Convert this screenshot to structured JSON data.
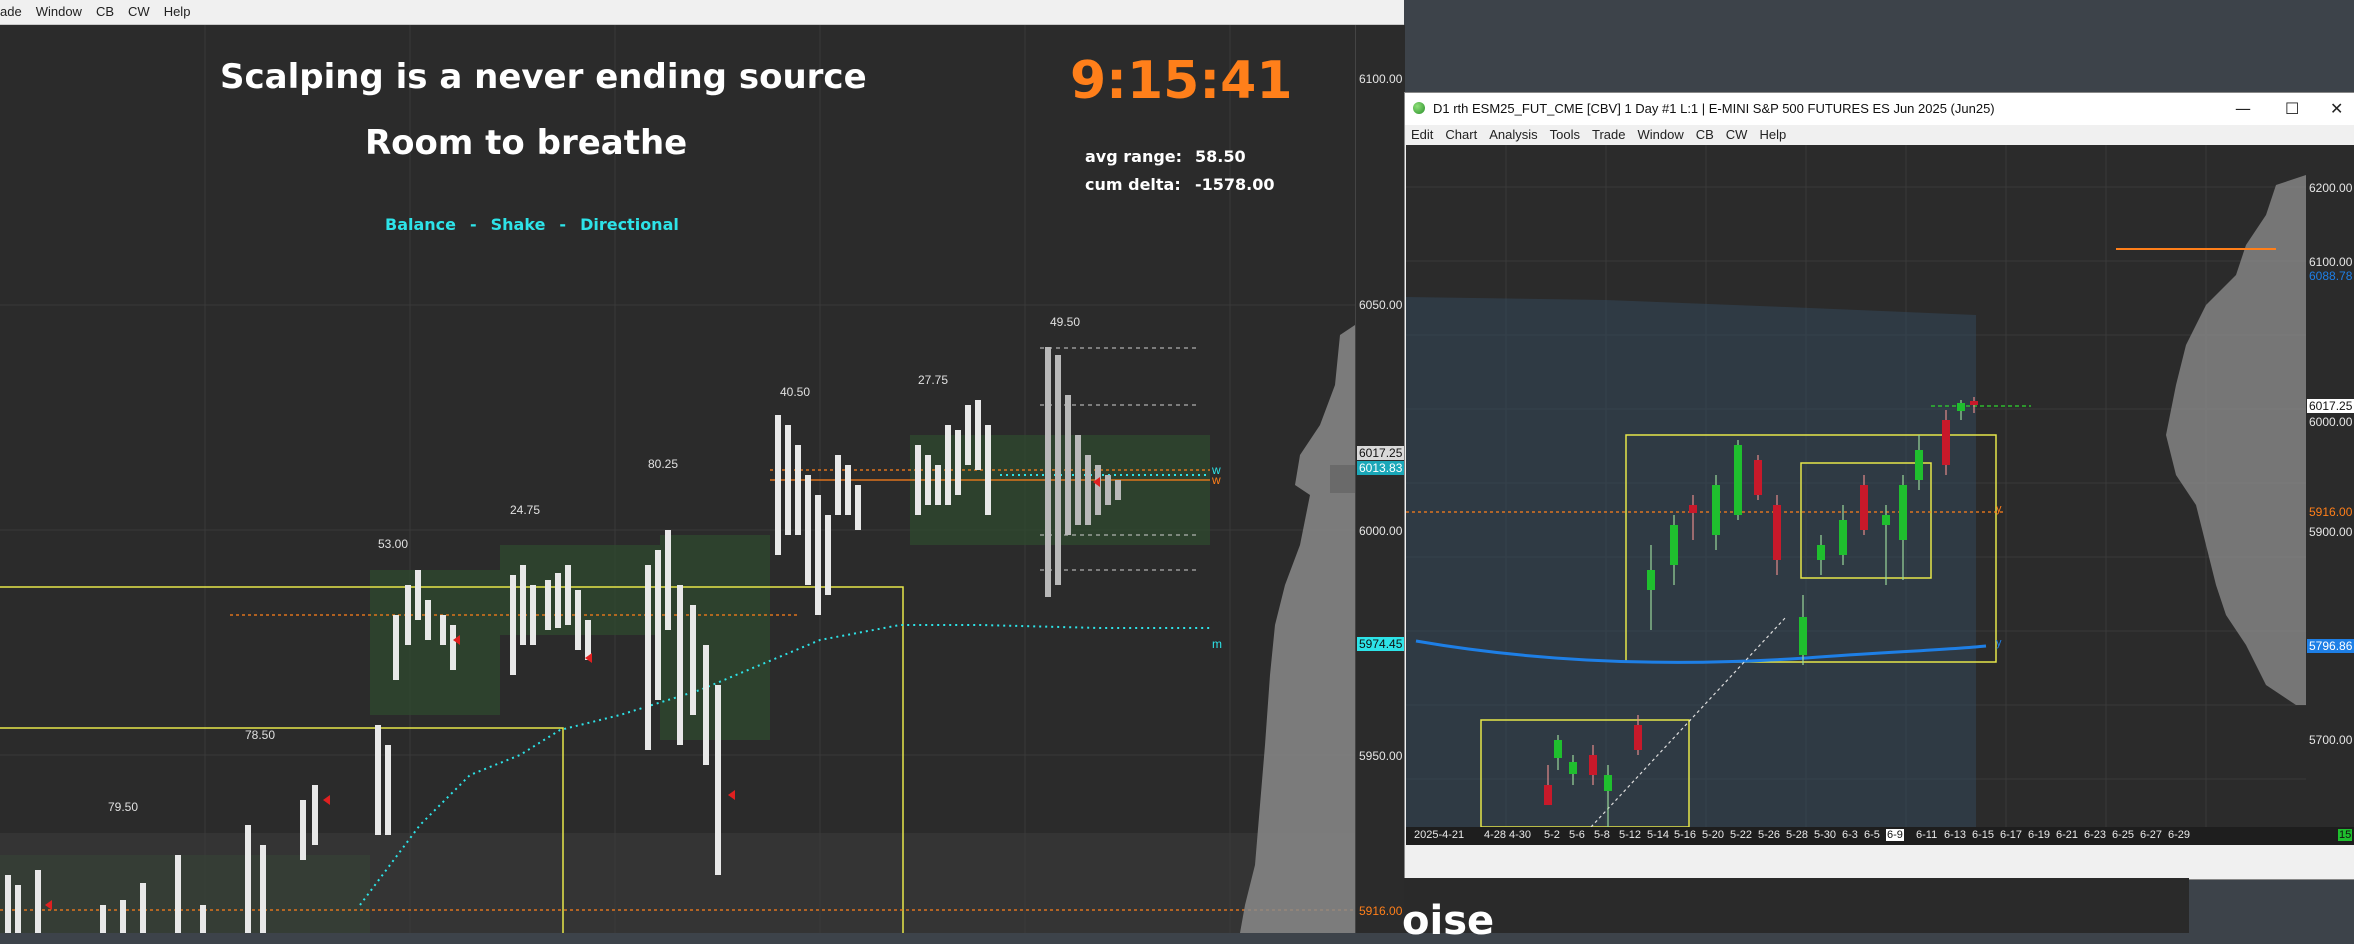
{
  "left_window": {
    "menu": [
      "ade",
      "Window",
      "CB",
      "CW",
      "Help"
    ],
    "title_line1": "Scalping is a never ending source",
    "title_line2": "Room to breathe",
    "clock": "9:15:41",
    "stats": {
      "avg_range_label": "avg range:",
      "avg_range_value": "58.50",
      "cum_delta_label": "cum delta:",
      "cum_delta_value": "-1578.00"
    },
    "phases": [
      "Balance",
      "-",
      "Shake",
      "-",
      "Directional"
    ],
    "bar_labels": [
      "79.50",
      "78.50",
      "53.00",
      "24.75",
      "80.25",
      "40.50",
      "27.75",
      "49.50"
    ],
    "price_axis": [
      "6100.00",
      "6050.00",
      "6017.25",
      "6013.83",
      "6000.00",
      "5974.45",
      "5950.00",
      "5916.00"
    ],
    "line_markers": [
      "w",
      "w",
      "m"
    ]
  },
  "right_window": {
    "title": "D1 rth ESM25_FUT_CME [CBV]  1 Day  #1 L:1 | E-MINI S&P 500 FUTURES ES Jun 2025 (Jun25)",
    "window_buttons": [
      "—",
      "☐",
      "✕"
    ],
    "menu": [
      "Edit",
      "Chart",
      "Analysis",
      "Tools",
      "Trade",
      "Window",
      "CB",
      "CW",
      "Help"
    ],
    "price_axis": [
      "6200.00",
      "6100.00",
      "6088.78",
      "6017.25",
      "6000.00",
      "5916.00",
      "5900.00",
      "5796.86",
      "5700.00"
    ],
    "date_axis": [
      "2025-4-21",
      "4-28",
      "4-30",
      "5-2",
      "5-6",
      "5-8",
      "5-12",
      "5-14",
      "5-16",
      "5-20",
      "5-22",
      "5-26",
      "5-28",
      "5-30",
      "6-3",
      "6-5",
      "6-9",
      "6-11",
      "6-13",
      "6-15",
      "6-17",
      "6-19",
      "6-21",
      "6-23",
      "6-25",
      "6-27",
      "6-29"
    ],
    "line_markers": [
      "y",
      "y"
    ],
    "axis_corner": "15"
  },
  "bottom_text": "oise",
  "colors": {
    "chart_bg": "#2b2b2b",
    "accent_orange": "#ff7f1a",
    "cyan": "#2de3e8",
    "yellow_box": "#e6e64a",
    "up_candle": "#1fbf2e",
    "down_candle": "#c8192a",
    "ma_line": "#1e7fe6"
  }
}
